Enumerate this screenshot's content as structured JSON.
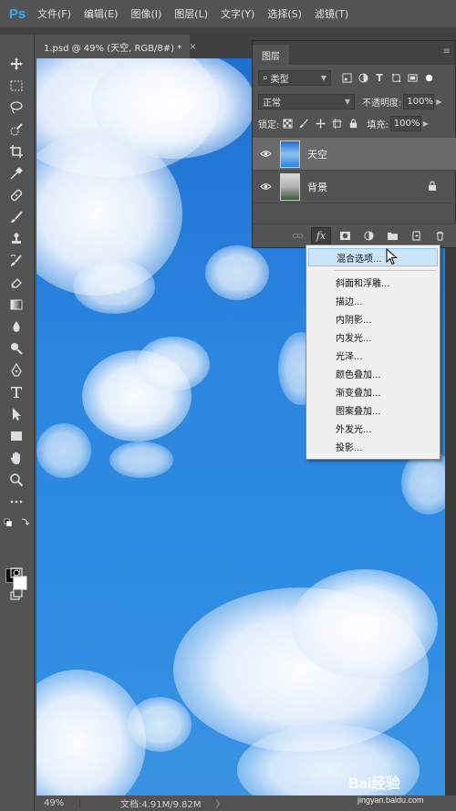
{
  "app": {
    "logo": "Ps"
  },
  "menu": [
    "文件(F)",
    "编辑(E)",
    "图像(I)",
    "图层(L)",
    "文字(Y)",
    "选择(S)",
    "滤镜(T)"
  ],
  "document_tab": {
    "title": "1.psd @ 49% (天空, RGB/8#) *",
    "close": "×"
  },
  "status": {
    "zoom": "49%",
    "doc_info": "文档:4.91M/9.82M",
    "arrow": "〉"
  },
  "layers_panel": {
    "tab_label": "图层",
    "filter_label": "类型",
    "blend_mode": "正常",
    "opacity_label": "不透明度:",
    "opacity_value": "100%",
    "lock_label": "锁定:",
    "fill_label": "填充:",
    "fill_value": "100%",
    "layers": [
      {
        "name": "天空",
        "selected": true,
        "locked": false
      },
      {
        "name": "背景",
        "selected": false,
        "locked": true
      }
    ],
    "footer_fx": "fx"
  },
  "fx_menu": {
    "items": [
      "混合选项...",
      "斜面和浮雕...",
      "描边...",
      "内阴影...",
      "内发光...",
      "光泽...",
      "颜色叠加...",
      "渐变叠加...",
      "图案叠加...",
      "外发光...",
      "投影..."
    ],
    "highlighted_index": 0
  },
  "watermark": {
    "text": "jingyan.baidu.com",
    "logo_text": "Bai经验"
  },
  "colors": {
    "accent": "#31a8ff",
    "foreground_swatch": "#000000",
    "background_swatch": "#ffffff",
    "selected_layer": "#6a6a6a",
    "menu_highlight": "#cce4f7"
  }
}
